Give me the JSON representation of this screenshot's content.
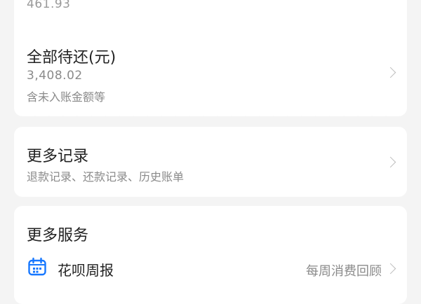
{
  "summary": {
    "previous_amount": "461.93"
  },
  "total_due": {
    "title": "全部待还(元)",
    "amount": "3,408.02",
    "note": "含未入账金额等"
  },
  "more_records": {
    "title": "更多记录",
    "subtitle": "退款记录、还款记录、历史账单"
  },
  "more_services": {
    "title": "更多服务",
    "items": [
      {
        "name": "花呗周报",
        "description": "每周消费回顾",
        "icon": "calendar-icon"
      }
    ]
  },
  "colors": {
    "accent": "#1677ff",
    "background": "#f4f4f4"
  }
}
